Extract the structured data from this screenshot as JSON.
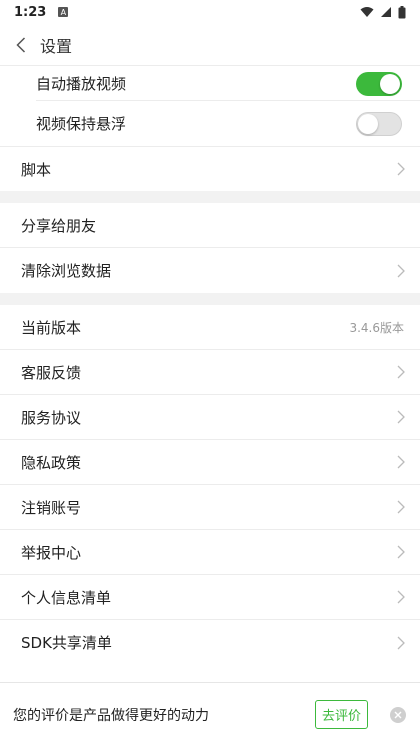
{
  "status_bar": {
    "time": "1:23",
    "notification_icon": "a-icon"
  },
  "header": {
    "title": "设置"
  },
  "toggles": [
    {
      "label": "自动播放视频",
      "state": "on"
    },
    {
      "label": "视频保持悬浮",
      "state": "off"
    }
  ],
  "rows": {
    "script": "脚本",
    "share": "分享给朋友",
    "clear": "清除浏览数据",
    "version_label": "当前版本",
    "version_value": "3.4.6版本",
    "feedback": "客服反馈",
    "agreement": "服务协议",
    "privacy": "隐私政策",
    "delete_account": "注销账号",
    "report": "举报中心",
    "personal_info": "个人信息清单",
    "sdk": "SDK共享清单"
  },
  "bottom_bar": {
    "message": "您的评价是产品做得更好的动力",
    "rate_button": "去评价"
  },
  "colors": {
    "accent": "#3cb93c",
    "divider": "#ececec",
    "section_gap": "#f2f2f2"
  }
}
